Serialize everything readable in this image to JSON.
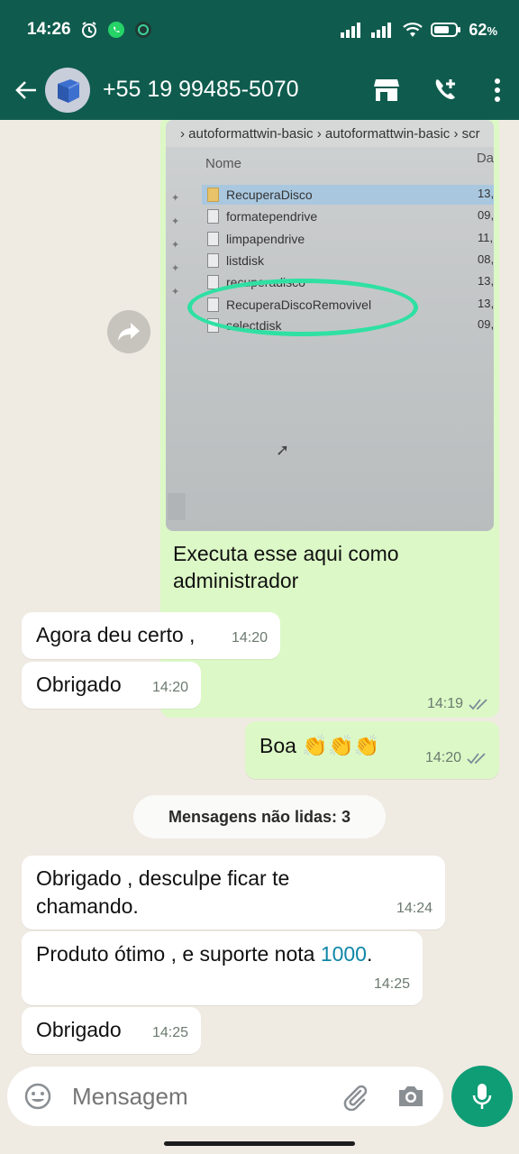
{
  "status_bar": {
    "time": "14:26",
    "battery": "62",
    "battery_unit": "%"
  },
  "header": {
    "contact_name": "+55 19 99485-5070"
  },
  "icons": {
    "back": "arrow-left-icon",
    "catalog": "store-icon",
    "call": "add-call-icon",
    "menu": "more-vert-icon",
    "forward": "forward-icon",
    "emoji": "emoji-icon",
    "attach": "paperclip-icon",
    "camera": "camera-icon",
    "mic": "mic-icon"
  },
  "colors": {
    "header": "#0f5c4e",
    "outgoing": "#dcf8c6",
    "incoming": "#ffffff",
    "background": "#efeae2",
    "accent": "#0f9d76",
    "highlight_circle": "#2fe0a3"
  },
  "media_message": {
    "screenshot": {
      "breadcrumb": "› autoformattwin-basic  ›  autoformattwin-basic  ›  scr",
      "column_name": "Nome",
      "column_date": "Da",
      "files": [
        {
          "name": "RecuperaDisco",
          "date": "13,"
        },
        {
          "name": "formatependrive",
          "date": "09,"
        },
        {
          "name": "limpapendrive",
          "date": "11,"
        },
        {
          "name": "listdisk",
          "date": "08,"
        },
        {
          "name": "recuperadisco",
          "date": "13,"
        },
        {
          "name": "RecuperaDiscoRemovivel",
          "date": "13,"
        },
        {
          "name": "selectdisk",
          "date": "09,"
        }
      ]
    },
    "caption": "Executa esse aqui como administrador",
    "time": "14:19"
  },
  "messages": [
    {
      "text": "Agora deu certo ,",
      "time": "14:20",
      "direction": "in"
    },
    {
      "text": "Obrigado",
      "time": "14:20",
      "direction": "in"
    },
    {
      "text": "Boa 👏👏👏",
      "time": "14:20",
      "direction": "out"
    },
    {
      "text": "Obrigado , desculpe ficar te chamando.",
      "time": "14:24",
      "direction": "in"
    },
    {
      "text_before": "Produto ótimo , e suporte nota ",
      "number": "1000",
      "text_after": ".",
      "time": "14:25",
      "direction": "in"
    },
    {
      "text": "Obrigado",
      "time": "14:25",
      "direction": "in"
    }
  ],
  "unread_banner": "Mensagens não lidas: 3",
  "composer": {
    "placeholder": "Mensagem"
  }
}
